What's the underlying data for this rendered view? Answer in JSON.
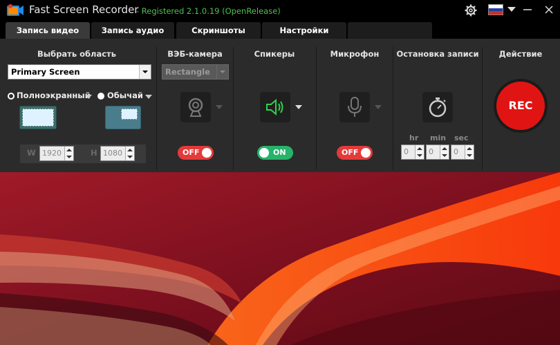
{
  "window": {
    "title": "Fast Screen Recorder",
    "subtitle": "- Registered 2.1.0.19 (OpenRelease)",
    "minimize_icon": "minimize-icon",
    "close_icon": "close-icon",
    "settings_icon": "gear-icon",
    "language_icon": "russian-flag-icon"
  },
  "tabs": [
    {
      "label": "Запись видео",
      "active": true
    },
    {
      "label": "Запись аудио",
      "active": false
    },
    {
      "label": "Скриншоты",
      "active": false
    },
    {
      "label": "Настройки",
      "active": false
    }
  ],
  "area": {
    "header": "Выбрать область",
    "screen_select": "Primary Screen",
    "fullscreen_label": "Полноэкранный",
    "normal_label": "Обычай",
    "fullscreen_selected": true,
    "w_label": "W",
    "w_value": "1920",
    "h_label": "H",
    "h_value": "1080"
  },
  "webcam": {
    "header": "ВЭБ-камера",
    "select_value": "Rectangle",
    "icon": "webcam-icon",
    "toggle": "OFF"
  },
  "speakers": {
    "header": "Спикеры",
    "icon": "speaker-icon",
    "toggle": "ON"
  },
  "microphone": {
    "header": "Микрофон",
    "icon": "microphone-icon",
    "toggle": "OFF"
  },
  "stop": {
    "header": "Остановка записи",
    "icon": "stopwatch-icon",
    "hr_label": "hr",
    "min_label": "min",
    "sec_label": "sec",
    "hr_value": "0",
    "min_value": "0",
    "sec_value": "0"
  },
  "action": {
    "header": "Действие",
    "rec_label": "REC"
  },
  "colors": {
    "accent_green": "#4ec24e",
    "toggle_off": "#e53a3a",
    "toggle_on": "#27b36a",
    "rec_red": "#e11414"
  }
}
